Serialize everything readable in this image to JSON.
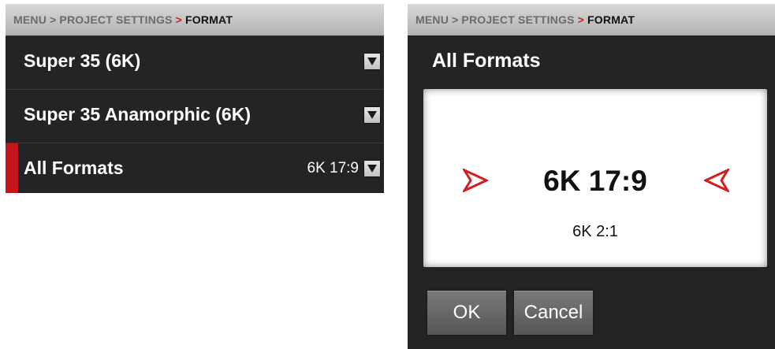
{
  "left": {
    "breadcrumb": {
      "menu": "MENU",
      "sep": ">",
      "project": "PROJECT SETTINGS",
      "arrow": ">",
      "current": "FORMAT"
    },
    "rows": [
      {
        "label": "Super 35 (6K)",
        "value": ""
      },
      {
        "label": "Super 35 Anamorphic (6K)",
        "value": ""
      },
      {
        "label": "All Formats",
        "value": "6K 17:9"
      }
    ]
  },
  "dialog": {
    "breadcrumb": {
      "menu": "MENU",
      "sep": ">",
      "project": "PROJECT SETTINGS",
      "arrow": ">",
      "current": "FORMAT"
    },
    "title": "All Formats",
    "selected": "6K 17:9",
    "next_option": "6K 2:1",
    "ok_label": "OK",
    "cancel_label": "Cancel"
  },
  "colors": {
    "accent": "#c4161c",
    "arrow_red": "#d01f1f",
    "background": "#242424"
  },
  "icons": {
    "dropdown": "chevron-down-icon",
    "prev": "arrow-left-icon",
    "next": "arrow-right-icon"
  }
}
